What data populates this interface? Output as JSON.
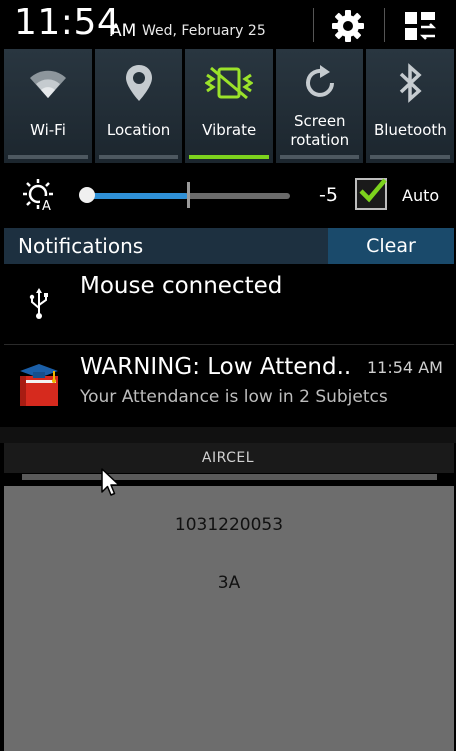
{
  "status": {
    "time": "11:54",
    "ampm": "AM",
    "date": "Wed, February 25",
    "settings_icon": "gear-icon",
    "menu_icon": "grid-switch-icon"
  },
  "toggles": [
    {
      "label": "Wi-Fi",
      "icon": "wifi-icon",
      "on": false
    },
    {
      "label": "Location",
      "icon": "location-pin-icon",
      "on": false
    },
    {
      "label": "Vibrate",
      "icon": "vibrate-icon",
      "on": true
    },
    {
      "label": "Screen\nrotation",
      "icon": "rotation-icon",
      "on": false
    },
    {
      "label": "Bluetooth",
      "icon": "bluetooth-icon",
      "on": false
    }
  ],
  "brightness": {
    "icon": "brightness-auto-icon",
    "value": "-5",
    "level_fraction": 0.5,
    "auto_checked": true,
    "auto_label": "Auto"
  },
  "notifications": {
    "title": "Notifications",
    "clear_label": "Clear",
    "items": [
      {
        "title": "Mouse connected",
        "icon": "usb-icon"
      },
      {
        "title": "WARNING: Low Attend..",
        "time": "11:54 AM",
        "text": "Your Attendance is low in 2 Subjetcs",
        "icon": "attendance-app-icon"
      }
    ]
  },
  "carrier": "AIRCEL",
  "lower": {
    "line1": "1031220053",
    "line2": "3A"
  },
  "colors": {
    "accent_on": "#7dd31d",
    "toggle_bg": "#293640",
    "notif_bar": "#1d3040",
    "clear_bg": "#1a4a6b",
    "slider": "#2f90d6",
    "lower_bg": "#6d6d6d"
  }
}
